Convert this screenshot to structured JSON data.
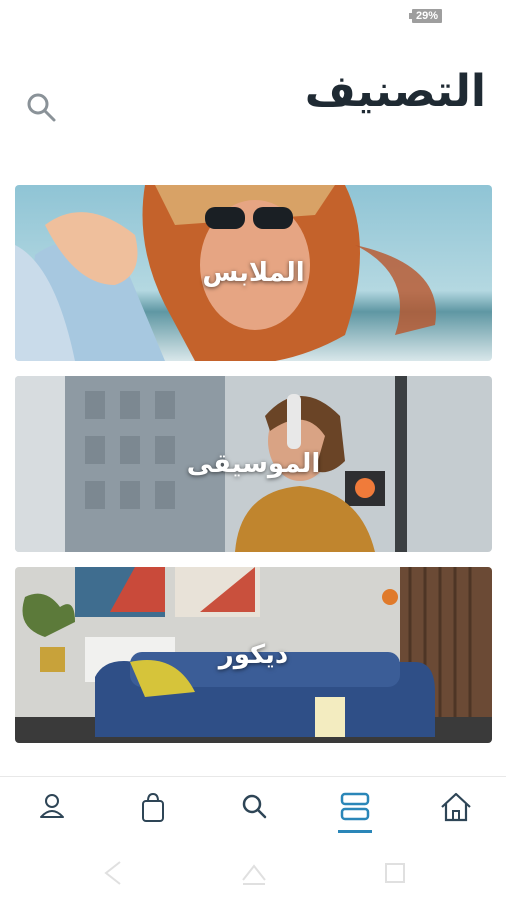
{
  "status_bar": {
    "battery": "29%"
  },
  "header": {
    "title": "التصنيف",
    "search_icon": "search-icon"
  },
  "categories": [
    {
      "label": "الملابس"
    },
    {
      "label": "الموسيقى"
    },
    {
      "label": "ديكور"
    }
  ],
  "bottom_nav": {
    "items": [
      {
        "icon": "profile-icon"
      },
      {
        "icon": "shopping-bag-icon"
      },
      {
        "icon": "search-icon"
      },
      {
        "icon": "categories-icon",
        "active": true
      },
      {
        "icon": "home-icon"
      }
    ],
    "accent_color": "#2a86b8"
  },
  "system_nav": {
    "icons": [
      "back-icon",
      "home-icon",
      "recents-icon"
    ]
  }
}
